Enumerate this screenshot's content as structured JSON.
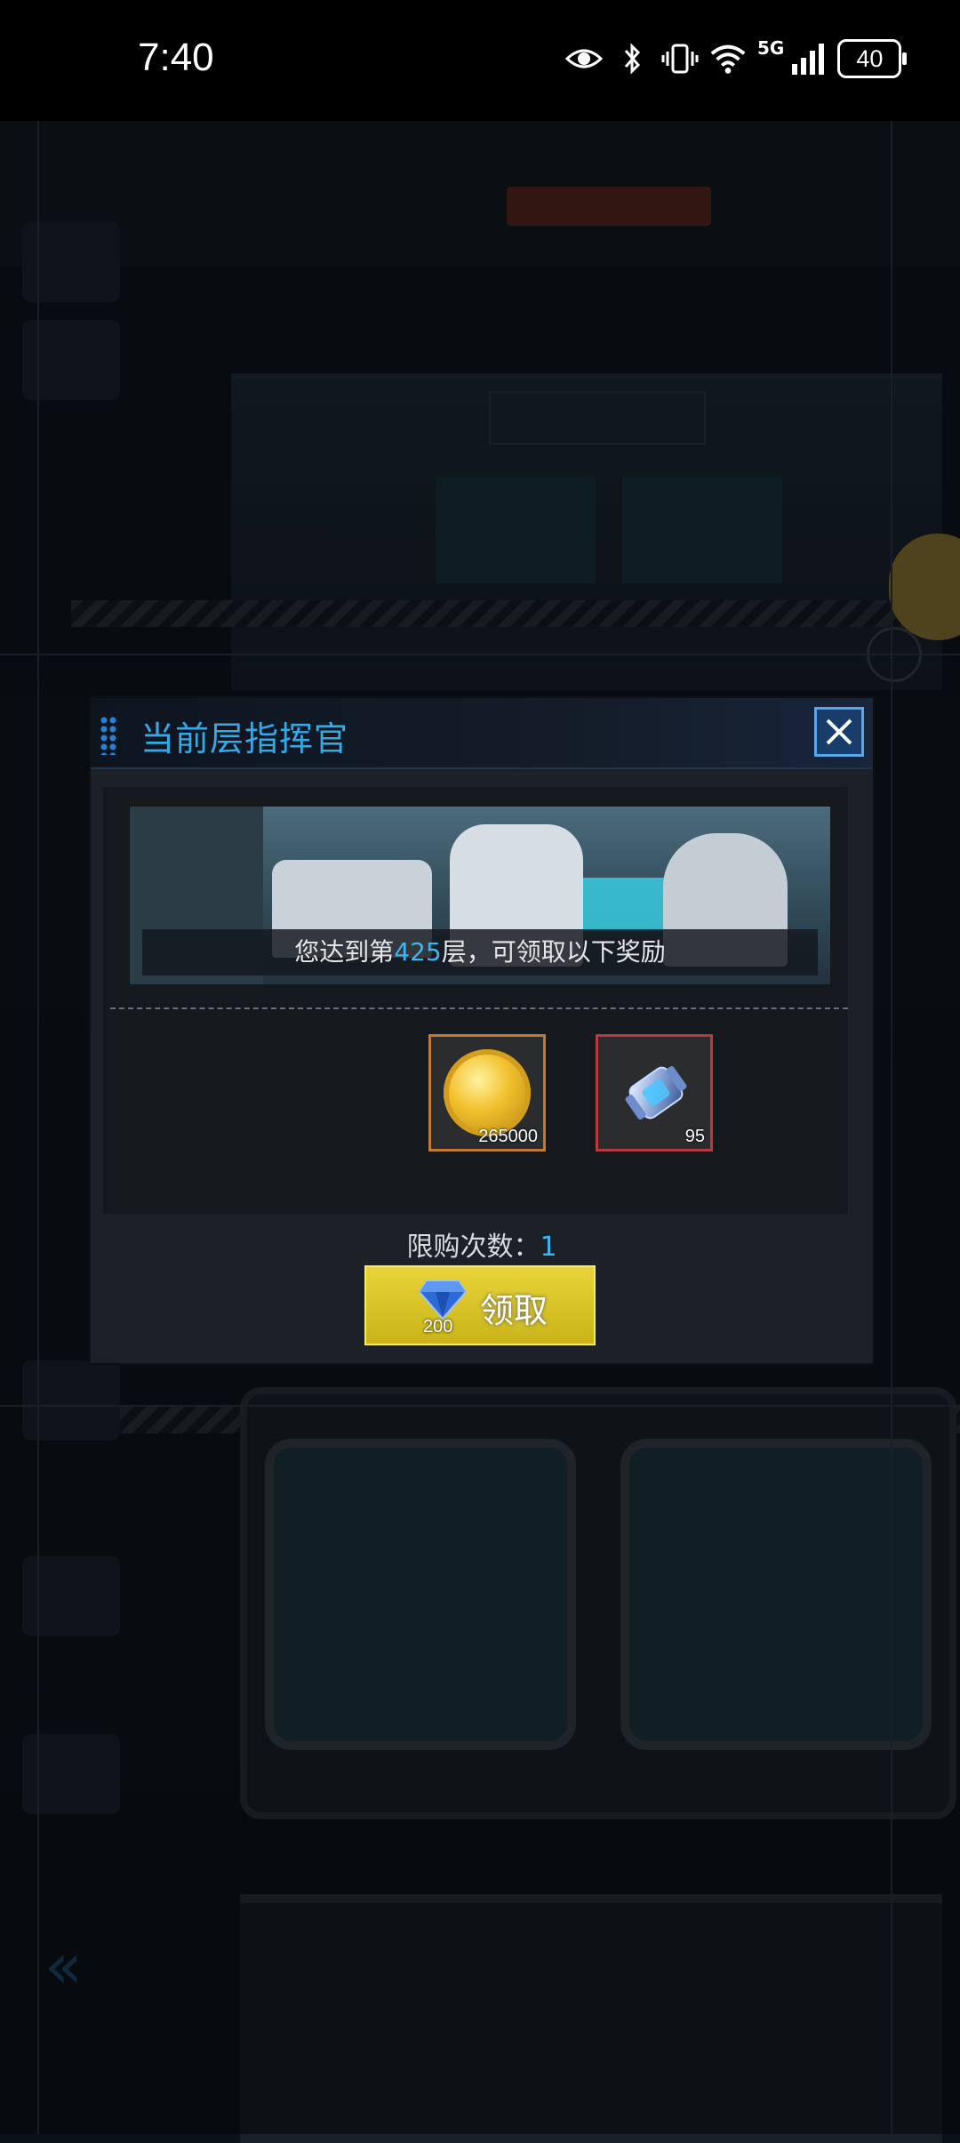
{
  "status_bar": {
    "time": "7:40",
    "network": "5G",
    "battery": "40"
  },
  "dialog": {
    "title": "当前层指挥官",
    "banner": {
      "caption_prefix": "您达到第",
      "floor": "425",
      "caption_suffix": "层，可领取以下奖励"
    },
    "rewards": [
      {
        "icon": "gold-coin-icon",
        "count": "265000",
        "border_color": "#c07a32"
      },
      {
        "icon": "energy-canister-icon",
        "count": "95",
        "border_color": "#b83a3e"
      }
    ],
    "limit_label": "限购次数：",
    "limit_value": "1",
    "claim_button": {
      "price": "200",
      "label": "领取",
      "currency_icon": "diamond-icon"
    }
  },
  "colors": {
    "accent_blue": "#3fb5f0",
    "button_yellow": "#e9d53a"
  }
}
